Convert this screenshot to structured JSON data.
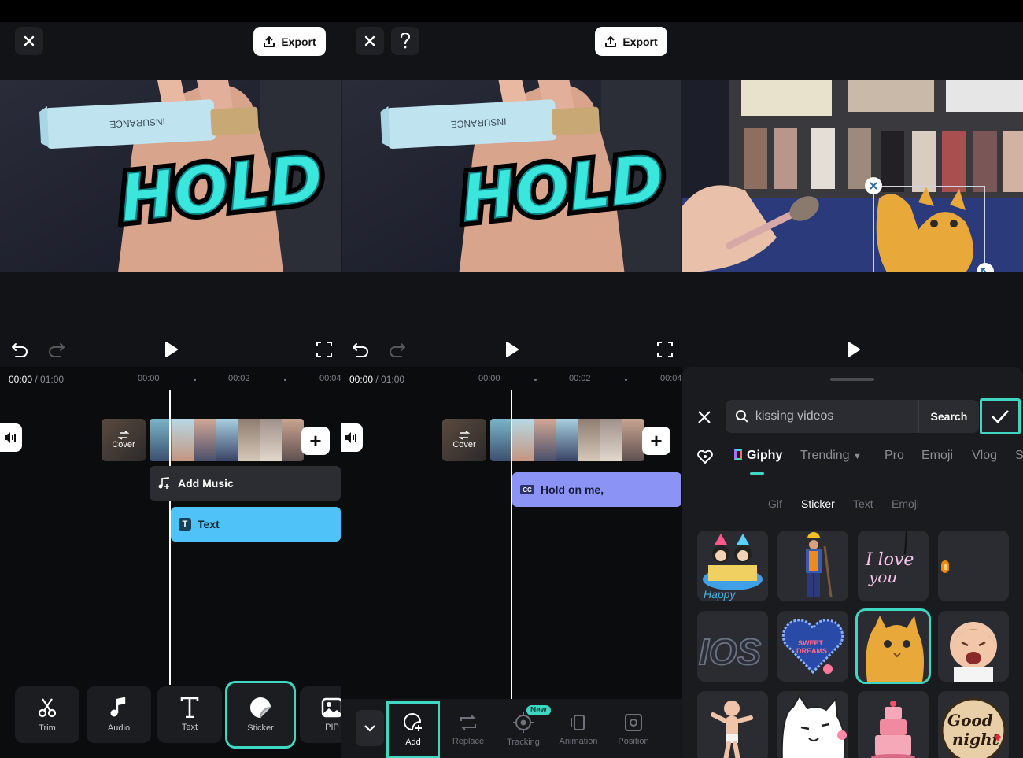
{
  "panel1": {
    "export_label": "Export",
    "time_current": "00:00",
    "time_total": " / 01:00",
    "ticks": [
      "00:00",
      "00:02",
      "00:04"
    ],
    "cover_label": "Cover",
    "tracks": {
      "music": "Add Music",
      "text": "Text"
    },
    "tools": [
      {
        "label": "Trim",
        "icon": "scissors-icon"
      },
      {
        "label": "Audio",
        "icon": "music-note-icon"
      },
      {
        "label": "Text",
        "icon": "text-icon"
      },
      {
        "label": "Sticker",
        "icon": "sticker-icon"
      },
      {
        "label": "PIP",
        "icon": "image-icon"
      }
    ]
  },
  "panel2": {
    "export_label": "Export",
    "time_current": "00:00",
    "time_total": " / 01:00",
    "ticks": [
      "00:00",
      "00:02",
      "00:04"
    ],
    "cover_label": "Cover",
    "caption_track": "Hold on me,",
    "tools": [
      {
        "label": "Add",
        "icon": "add-sticker-icon"
      },
      {
        "label": "Replace",
        "icon": "replace-icon"
      },
      {
        "label": "Tracking",
        "icon": "tracking-icon",
        "badge": "New"
      },
      {
        "label": "Animation",
        "icon": "animation-icon"
      },
      {
        "label": "Position",
        "icon": "position-icon"
      }
    ]
  },
  "panel3": {
    "search_value": "kissing videos",
    "search_button": "Search",
    "categories": [
      "Giphy",
      "Trending",
      "Pro",
      "Emoji",
      "Vlog",
      "S"
    ],
    "subcategories": [
      "Gif",
      "Sticker",
      "Text",
      "Emoji"
    ]
  },
  "preview_text": "HOLD",
  "colors": {
    "accent": "#3fd6c2",
    "text_track": "#4fc3f7",
    "caption_track": "#8b93f5"
  }
}
